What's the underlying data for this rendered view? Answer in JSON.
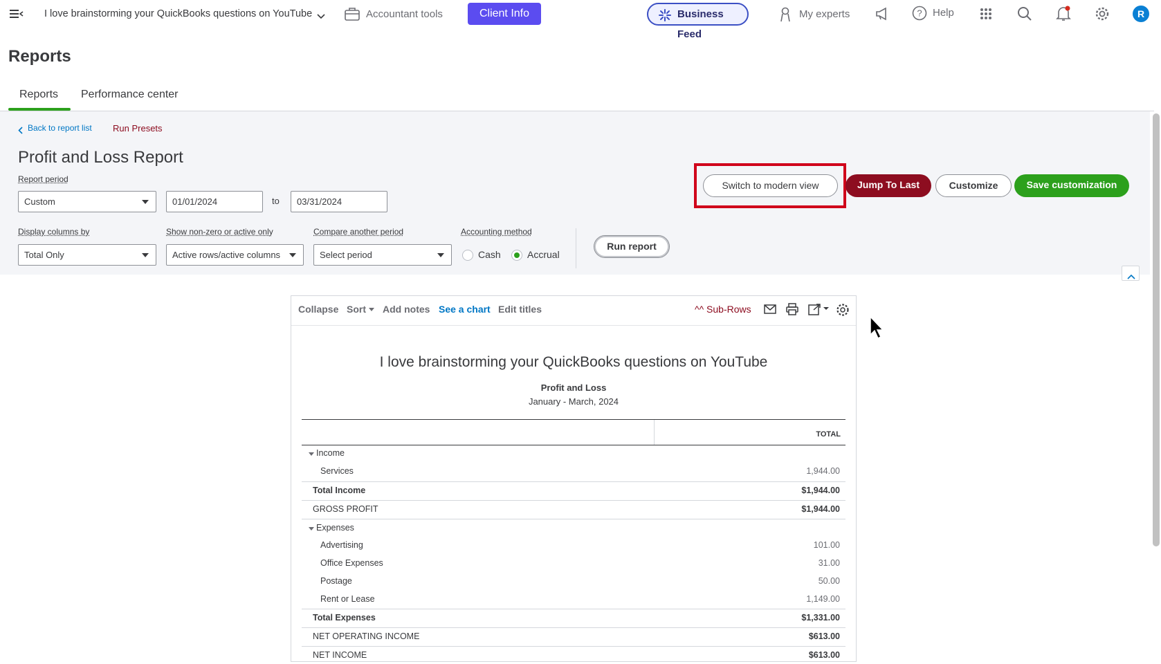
{
  "topbar": {
    "company_name": "I love brainstorming your QuickBooks questions on YouTube",
    "accountant_tools": "Accountant tools",
    "client_info": "Client Info",
    "business_feed": "Business Feed",
    "my_experts": "My experts",
    "help": "Help",
    "avatar_initial": "R"
  },
  "page": {
    "title": "Reports",
    "tabs": [
      {
        "label": "Reports",
        "active": true
      },
      {
        "label": "Performance center",
        "active": false
      }
    ]
  },
  "panel": {
    "back_link": "Back to report list",
    "run_presets": "Run Presets",
    "report_title": "Profit and Loss Report",
    "report_period_label": "Report period",
    "report_period_value": "Custom",
    "date_from": "01/01/2024",
    "date_to_label": "to",
    "date_to": "03/31/2024",
    "display_columns_label": "Display columns by",
    "display_columns_value": "Total Only",
    "show_nonzero_label": "Show non-zero or active only",
    "show_nonzero_value": "Active rows/active columns",
    "compare_label": "Compare another period",
    "compare_value": "Select period",
    "accounting_method_label": "Accounting method",
    "cash_label": "Cash",
    "accrual_label": "Accrual",
    "accounting_method_selected": "Accrual",
    "run_report": "Run report",
    "switch_modern": "Switch to modern view",
    "jump_to_last": "Jump To Last",
    "customize": "Customize",
    "save_customization": "Save customization"
  },
  "colors": {
    "brand_green": "#2ca01c",
    "client_info_bg": "#5b4cf0",
    "jump_bg": "#8d0d20",
    "highlight": "#d0021b",
    "link_blue": "#0077c5"
  },
  "report_toolbar": {
    "collapse": "Collapse",
    "sort": "Sort",
    "add_notes": "Add notes",
    "see_chart": "See a chart",
    "edit_titles": "Edit titles",
    "sub_rows": "^^ Sub-Rows"
  },
  "report": {
    "company": "I love brainstorming your QuickBooks questions on YouTube",
    "name": "Profit and Loss",
    "period": "January - March, 2024",
    "column_header": "TOTAL",
    "rows": [
      {
        "label": "Income",
        "value": "",
        "kind": "section"
      },
      {
        "label": "Services",
        "value": "1,944.00",
        "kind": "item"
      },
      {
        "label": "Total Income",
        "value": "$1,944.00",
        "kind": "total"
      },
      {
        "label": "GROSS PROFIT",
        "value": "$1,944.00",
        "kind": "summary"
      },
      {
        "label": "Expenses",
        "value": "",
        "kind": "section"
      },
      {
        "label": "Advertising",
        "value": "101.00",
        "kind": "item"
      },
      {
        "label": "Office Expenses",
        "value": "31.00",
        "kind": "item"
      },
      {
        "label": "Postage",
        "value": "50.00",
        "kind": "item"
      },
      {
        "label": "Rent or Lease",
        "value": "1,149.00",
        "kind": "item"
      },
      {
        "label": "Total Expenses",
        "value": "$1,331.00",
        "kind": "total"
      },
      {
        "label": "NET OPERATING INCOME",
        "value": "$613.00",
        "kind": "summary"
      },
      {
        "label": "NET INCOME",
        "value": "$613.00",
        "kind": "summary"
      }
    ]
  }
}
